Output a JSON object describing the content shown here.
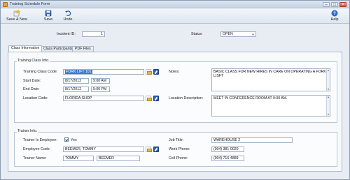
{
  "window": {
    "title": "Training Schedule Form"
  },
  "toolbar": {
    "save_new_label": "Save & New",
    "save_label": "Save",
    "undo_label": "Undo",
    "help_label": "Help"
  },
  "header": {
    "incident_label": "Incident ID:",
    "incident_value": "1",
    "status_label": "Status:",
    "status_value": "OPEN"
  },
  "tabs": [
    {
      "label": "Class Information"
    },
    {
      "label": "Class Participants"
    },
    {
      "label": "PDF Files"
    }
  ],
  "training_class": {
    "group_title": "Training Class Info.",
    "class_code_label": "Training Class Code:",
    "class_code_value": "FORK LIFT 101",
    "start_date_label": "Start Date:",
    "start_date_value": "8/17/2012",
    "start_time_value": "9:00 AM",
    "end_date_label": "End Date:",
    "end_date_value": "8/17/2012",
    "end_time_value": "5:00 PM",
    "location_code_label": "Location Code:",
    "location_code_value": "FLORIDA SHOP",
    "notes_label": "Notes:",
    "notes_value": "BASIC CLASS FOR NEW HIRES IN CARE ON OPERATING A FORK LISFT",
    "location_desc_label": "Location Description:",
    "location_desc_value": "MEET IN CONFERENCE ROOM AT 9:00 AM."
  },
  "trainer": {
    "group_title": "Trainer Info.",
    "is_employee_label": "Trainer Is Employee:",
    "is_employee_checked": true,
    "is_employee_value": "Yes",
    "employee_code_label": "Employee Code:",
    "employee_code_value": "BEEMER, TOMMY",
    "trainer_name_label": "Trainer Name:",
    "first_name_value": "TOMMY",
    "last_name_value": "BEEMER",
    "job_title_label": "Job Title:",
    "job_title_value": "WAREHOUSE 2",
    "work_phone_label": "Work Phone:",
    "work_phone_value": "(904) 381-0020",
    "cell_phone_label": "Cell Phone:",
    "cell_phone_value": "(904) 716-4889"
  },
  "icons": {
    "app": "form-icon",
    "save_new": "save-new-icon",
    "save": "floppy-disk-icon",
    "undo": "undo-arrow-icon",
    "help": "help-question-icon",
    "folder": "folder-icon",
    "edit": "edit-pencil-icon"
  },
  "colors": {
    "selection_highlight": "#3a78d6",
    "accent_blue": "#2c5fb3",
    "titlebar": "#c6d4e6"
  }
}
